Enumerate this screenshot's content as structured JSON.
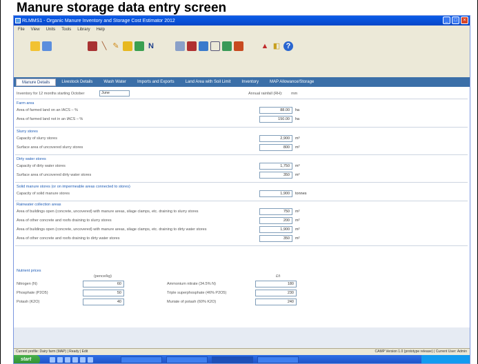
{
  "caption": "Manure storage data entry screen",
  "window": {
    "title": "RLMMS1 - Organic Manure Inventory and Storage Cost Estimator 2012"
  },
  "menu": [
    "File",
    "View",
    "Units",
    "Tools",
    "Library",
    "Help"
  ],
  "tabs": [
    "Manure Details",
    "Livestock Details",
    "Wash Water",
    "Imports and Exports",
    "Land Area with Soil Limit",
    "Inventory",
    "MAP Allowance/Storage"
  ],
  "top_field": {
    "label": "Inventory for 12 months starting October",
    "value": "June",
    "right_label": "Annual rainfall (RH):",
    "right_value": "mm"
  },
  "sections": {
    "farm_area": {
      "title": "Farm area",
      "rows": [
        {
          "label": "Area of farmed land on an IACS – %",
          "value": "88.00",
          "unit": "ha"
        },
        {
          "label": "Area of farmed land not in an IACS – %",
          "value": "150.00",
          "unit": "ha"
        }
      ]
    },
    "slurry_stores": {
      "title": "Slurry stores",
      "rows": [
        {
          "label": "Capacity of slurry stores",
          "value": "2,900",
          "unit": "m³"
        },
        {
          "label": "Surface area of uncovered slurry stores",
          "value": "800",
          "unit": "m²"
        }
      ]
    },
    "dirty_water_stores": {
      "title": "Dirty water stores",
      "rows": [
        {
          "label": "Capacity of dirty water stores",
          "value": "1,750",
          "unit": "m³"
        },
        {
          "label": "Surface area of uncovered dirty water stores",
          "value": "350",
          "unit": "m²"
        }
      ]
    },
    "solid_manure_stores": {
      "title": "Solid manure stores (or on impermeable areas connected to stores)",
      "rows": [
        {
          "label": "Capacity of solid manure stores",
          "value": "1,900",
          "unit": "tonnes"
        }
      ]
    },
    "rainwater_areas": {
      "title": "Rainwater collection areas",
      "rows": [
        {
          "label": "Area of buildings open (concrete, uncovered) with manure areas, silage clamps, etc. draining to slurry stores",
          "value": "750",
          "unit": "m²"
        },
        {
          "label": "Area of other concrete and roofs draining to slurry stores",
          "value": "200",
          "unit": "m²"
        },
        {
          "label": "Area of buildings open (concrete, uncovered) with manure areas, silage clamps, etc. draining to dirty water stores",
          "value": "1,900",
          "unit": "m²"
        },
        {
          "label": "Area of other concrete and roofs draining to dirty water stores",
          "value": "350",
          "unit": "m²"
        }
      ]
    },
    "nutrients": {
      "title": "Nutrient prices",
      "col_header_left": "(pence/kg)",
      "col_header_right": "£/t",
      "left_rows": [
        {
          "label": "Nitrogen (N)",
          "value": "60"
        },
        {
          "label": "Phosphate (P2O5)",
          "value": "50"
        },
        {
          "label": "Potash (K2O)",
          "value": "40"
        }
      ],
      "right_rows": [
        {
          "label": "Ammonium nitrate (34.5% N)",
          "value": "180"
        },
        {
          "label": "Triple superphosphate (46% P2O5)",
          "value": "230"
        },
        {
          "label": "Muriate of potash (60% K2O)",
          "value": "240"
        }
      ]
    }
  },
  "status": {
    "left": "Current profile: Dairy farm (MAP) | Ready | Edit",
    "right": "CAMP Version 1.0 (prototype release) | Current User: Admin"
  },
  "taskbar": {
    "start": "start",
    "tasks": [
      "",
      "",
      "",
      ""
    ],
    "clock": ""
  }
}
